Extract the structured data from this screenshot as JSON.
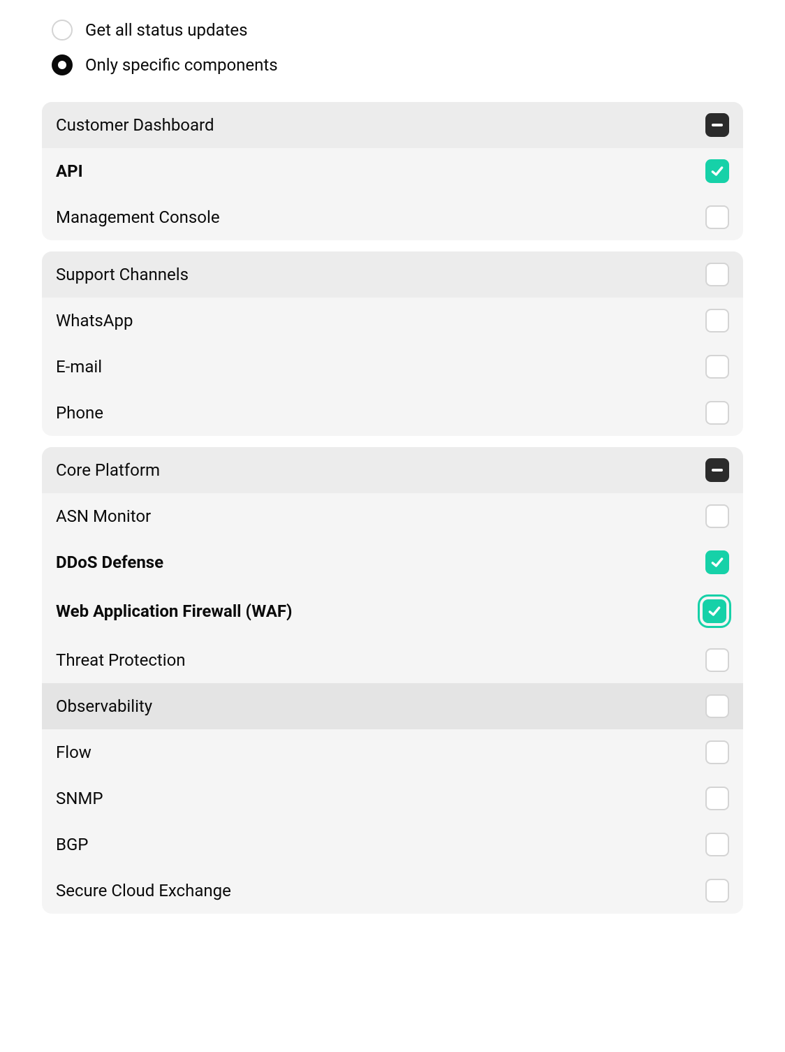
{
  "radios": {
    "all": {
      "label": "Get all status updates",
      "selected": false
    },
    "specific": {
      "label": "Only specific components",
      "selected": true
    }
  },
  "groups": [
    {
      "header": {
        "label": "Customer Dashboard",
        "state": "indeterminate"
      },
      "items": [
        {
          "label": "API",
          "state": "checked"
        },
        {
          "label": "Management Console",
          "state": "unchecked"
        }
      ]
    },
    {
      "header": {
        "label": "Support Channels",
        "state": "unchecked"
      },
      "items": [
        {
          "label": "WhatsApp",
          "state": "unchecked"
        },
        {
          "label": "E-mail",
          "state": "unchecked"
        },
        {
          "label": "Phone",
          "state": "unchecked"
        }
      ]
    },
    {
      "header": {
        "label": "Core Platform",
        "state": "indeterminate"
      },
      "items": [
        {
          "label": "ASN Monitor",
          "state": "unchecked"
        },
        {
          "label": "DDoS Defense",
          "state": "checked"
        },
        {
          "label": "Web Application Firewall (WAF)",
          "state": "checked",
          "focused": true
        },
        {
          "label": "Threat Protection",
          "state": "unchecked"
        },
        {
          "label": "Observability",
          "state": "unchecked",
          "hover": true
        },
        {
          "label": "Flow",
          "state": "unchecked"
        },
        {
          "label": "SNMP",
          "state": "unchecked"
        },
        {
          "label": "BGP",
          "state": "unchecked"
        },
        {
          "label": "Secure Cloud Exchange",
          "state": "unchecked"
        }
      ]
    }
  ],
  "colors": {
    "accent": "#16d1a8"
  }
}
